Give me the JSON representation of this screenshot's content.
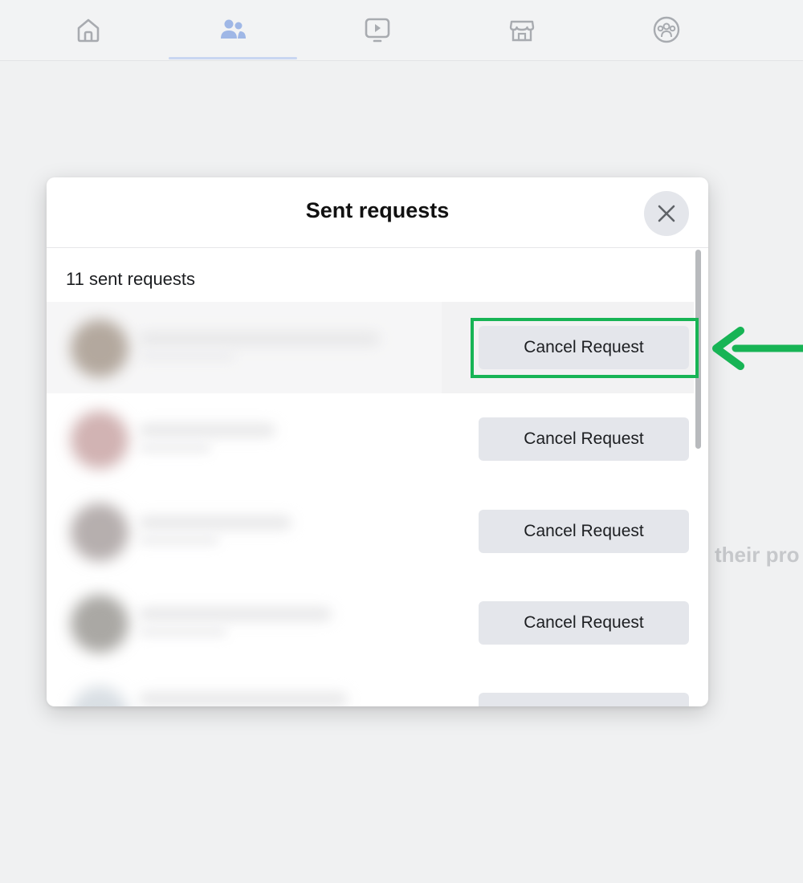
{
  "nav": {
    "tabs": [
      {
        "name": "home",
        "icon": "home-icon",
        "active": false
      },
      {
        "name": "friends",
        "icon": "friends-icon",
        "active": true
      },
      {
        "name": "watch",
        "icon": "watch-icon",
        "active": false
      },
      {
        "name": "marketplace",
        "icon": "marketplace-icon",
        "active": false
      },
      {
        "name": "groups",
        "icon": "groups-icon",
        "active": false
      }
    ]
  },
  "background": {
    "peek_text": "their pro"
  },
  "modal": {
    "title": "Sent requests",
    "count_label": "11 sent requests",
    "close_icon": "close-icon",
    "requests": [
      {
        "button_label": "Cancel Request",
        "highlighted": true
      },
      {
        "button_label": "Cancel Request",
        "highlighted": false
      },
      {
        "button_label": "Cancel Request",
        "highlighted": false
      },
      {
        "button_label": "Cancel Request",
        "highlighted": false
      },
      {
        "button_label": "",
        "highlighted": false
      }
    ]
  },
  "annotation": {
    "highlight_color": "#17b455",
    "arrow_icon": "arrow-left-icon"
  },
  "colors": {
    "button_bg": "#e4e6eb",
    "active_tab_indicator": "#c9d6f1",
    "nav_icon": "#a8abb0",
    "active_nav_icon": "#9fb7e6"
  }
}
